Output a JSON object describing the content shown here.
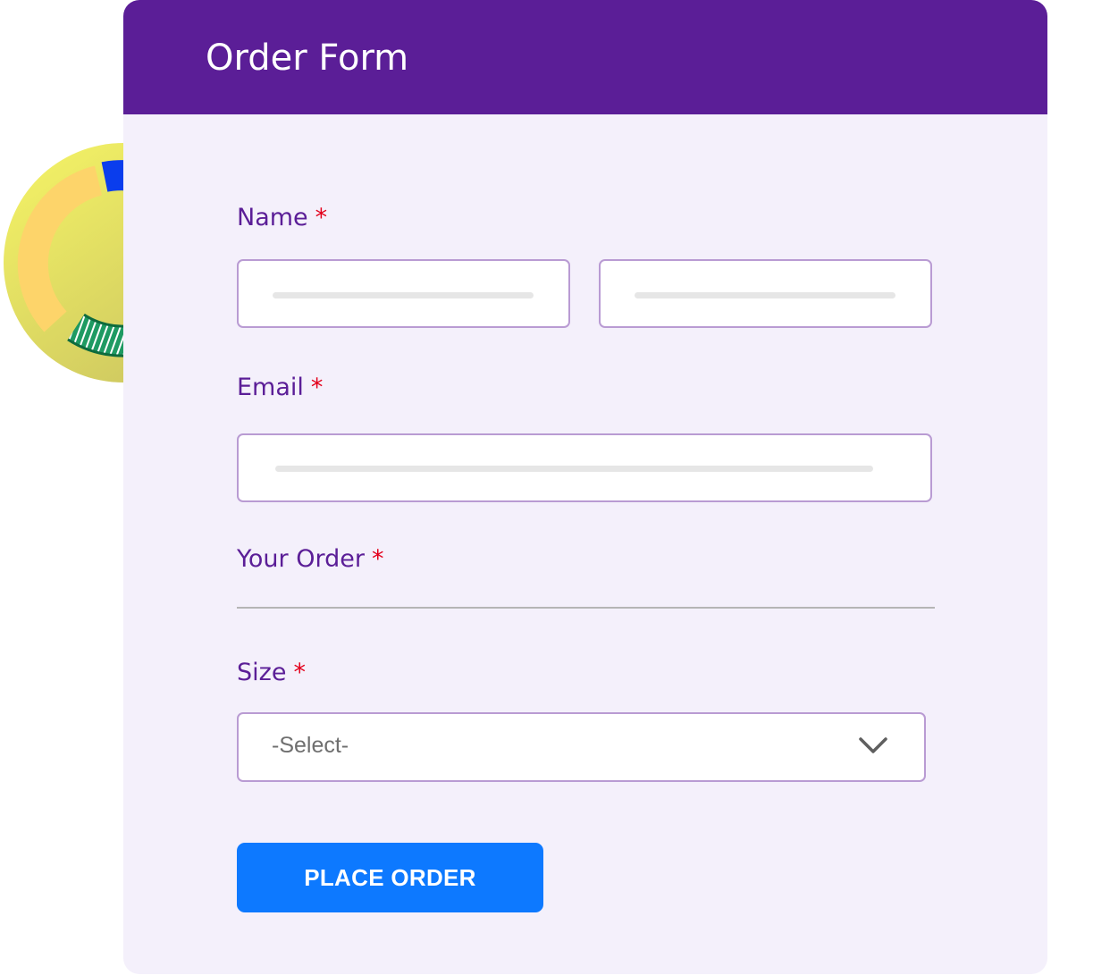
{
  "form": {
    "title": "Order Form",
    "required_marker": "*",
    "fields": {
      "name": {
        "label": "Name"
      },
      "email": {
        "label": "Email"
      },
      "order": {
        "label": "Your Order"
      },
      "size": {
        "label": "Size",
        "selected": "-Select-"
      }
    },
    "submit_label": "PLACE ORDER"
  },
  "colors": {
    "header": "#5b1e97",
    "label": "#5b1e97",
    "required": "#e3001b",
    "button": "#0d79ff",
    "card_background": "#f4f0fb",
    "input_border": "#b99bd3"
  },
  "icons": {
    "select": "chevron-down-icon",
    "decoration": "donut-chart-illustration"
  }
}
